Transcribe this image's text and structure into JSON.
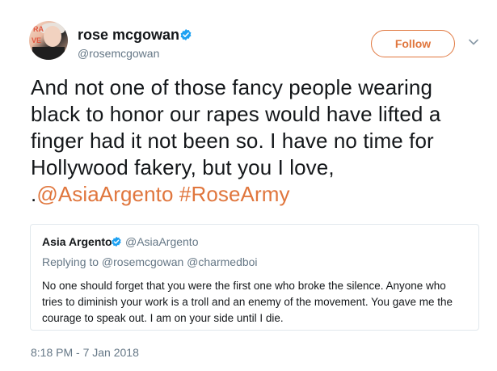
{
  "author": {
    "display_name": "rose mcgowan",
    "handle": "@rosemcgowan",
    "avatar_text_top": "RA",
    "avatar_text_mid": "VE"
  },
  "follow_button": {
    "label": "Follow"
  },
  "tweet": {
    "lines": [
      "And not one of those fancy people wearing",
      "black to honor our rapes would have lifted a",
      "finger had it not been so. I have no time for",
      "Hollywood fakery, but you I love,"
    ],
    "last_line_prefix": ".",
    "mention": "@AsiaArgento",
    "hashtag": "#RoseArmy"
  },
  "quote": {
    "display_name": "Asia Argento",
    "handle": "@AsiaArgento",
    "replying_to": "Replying to @rosemcgowan @charmedboi",
    "body_lines": [
      "No one should forget that you were the first one who broke the silence. Anyone who",
      "tries to diminish your work is a troll and an enemy of the movement. You gave me the",
      "courage to speak out. I am on your side until I die."
    ]
  },
  "timestamp": "8:18 PM - 7 Jan 2018",
  "colors": {
    "accent": "#e0763d",
    "verified": "#1da1f2",
    "secondary_text": "#657786",
    "border": "#e1e8ed"
  },
  "icons": {
    "verified": "verified-badge-icon",
    "more": "chevron-down-icon"
  }
}
